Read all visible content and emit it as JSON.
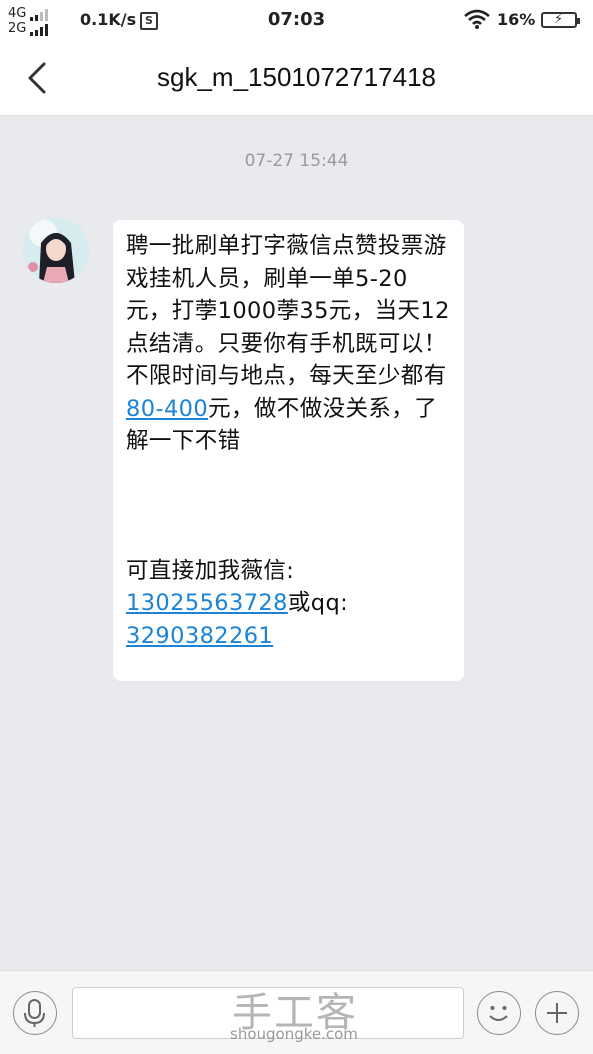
{
  "status_bar": {
    "network_top": "4G",
    "network_bottom": "2G",
    "speed": "0.1K/s",
    "sim_icon_letter": "S",
    "time": "07:03",
    "battery_percent": "16%",
    "battery_level": 0.16,
    "icons": [
      "signal-icon",
      "wifi-icon",
      "battery-icon",
      "charging-icon"
    ]
  },
  "header": {
    "back_icon": "chevron-left-icon",
    "title": "sgk_m_1501072717418"
  },
  "conversation": {
    "timestamp": "07-27 15:44",
    "message": {
      "text_1": "聘一批刷单打字薇信点赞投票游戏挂机人员，刷单一单5-20元，打荸1000荸35元，当天12点结清。只要你有手机既可以！不限时间与地点，每天至少都有",
      "link_1": "80-400",
      "text_2": "元，做不做没关系，了解一下不错",
      "text_3": "可直接加我薇信:",
      "link_2": "13025563728",
      "text_4": "或qq:",
      "link_3": "3290382261"
    }
  },
  "input_bar": {
    "icons": [
      "microphone-icon",
      "emoji-icon",
      "plus-icon"
    ]
  },
  "watermark": {
    "cn": "手工客",
    "en": "shougongke.com"
  },
  "colors": {
    "link": "#1b84d6",
    "background": "#e9eaee",
    "bubble": "#ffffff"
  }
}
